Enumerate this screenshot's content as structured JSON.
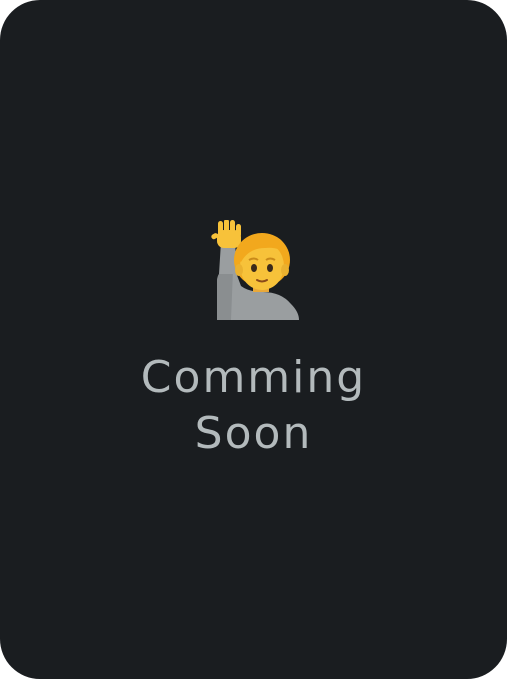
{
  "card": {
    "background": "#1a1d20",
    "emoji_icon": "person-raising-hand-icon",
    "title_line1": "Comming",
    "title_line2": "Soon",
    "title_color": "#b3babc"
  }
}
